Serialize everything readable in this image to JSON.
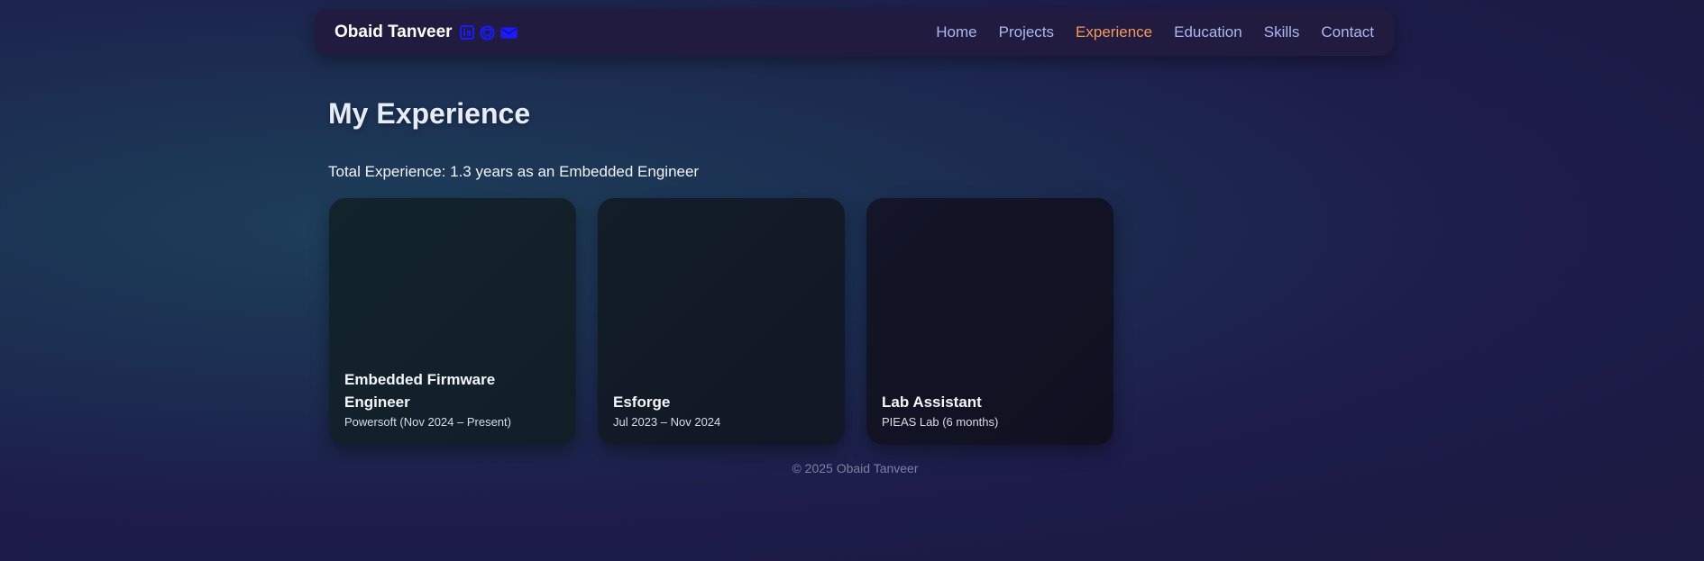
{
  "header": {
    "brand_name": "Obaid Tanveer",
    "icons": [
      "linkedin-icon",
      "github-icon",
      "email-icon"
    ],
    "nav": [
      {
        "label": "Home",
        "active": false
      },
      {
        "label": "Projects",
        "active": false
      },
      {
        "label": "Experience",
        "active": true
      },
      {
        "label": "Education",
        "active": false
      },
      {
        "label": "Skills",
        "active": false
      },
      {
        "label": "Contact",
        "active": false
      }
    ]
  },
  "main": {
    "title": "My Experience",
    "total_experience": "Total Experience: 1.3 years as an Embedded Engineer",
    "cards": [
      {
        "title": "Embedded Firmware Engineer",
        "subtitle": "Powersoft (Nov 2024 – Present)"
      },
      {
        "title": "Esforge",
        "subtitle": "Jul 2023 – Nov 2024"
      },
      {
        "title": "Lab Assistant",
        "subtitle": "PIEAS Lab (6 months)"
      }
    ]
  },
  "footer": {
    "text": "© 2025 Obaid Tanveer"
  },
  "colors": {
    "accent_active_nav": "#f39a5a",
    "nav_link": "#a9b8f0",
    "icon_blue": "#1a1aff"
  }
}
